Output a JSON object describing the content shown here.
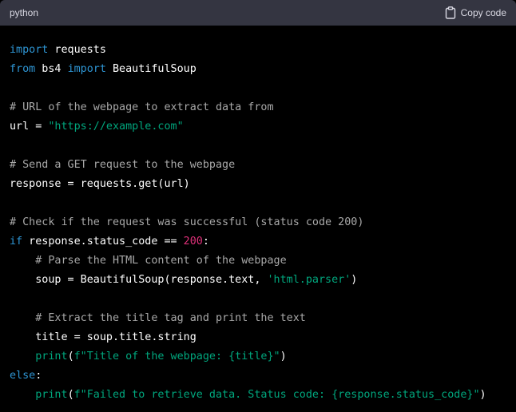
{
  "header": {
    "language": "python",
    "copy_label": "Copy code"
  },
  "colors": {
    "keyword": "#2e95d3",
    "comment": "#a8a8a8",
    "string": "#00a67d",
    "number": "#df3079",
    "plain": "#ffffff",
    "header_bg": "#343541",
    "code_bg": "#000000"
  },
  "icons": {
    "copy": "clipboard-icon"
  },
  "code": {
    "lines": [
      [
        {
          "t": "import",
          "c": "kw"
        },
        {
          "t": " requests",
          "c": "pl"
        }
      ],
      [
        {
          "t": "from",
          "c": "kw"
        },
        {
          "t": " bs4 ",
          "c": "pl"
        },
        {
          "t": "import",
          "c": "kw"
        },
        {
          "t": " BeautifulSoup",
          "c": "pl"
        }
      ],
      [],
      [
        {
          "t": "# URL of the webpage to extract data from",
          "c": "cm"
        }
      ],
      [
        {
          "t": "url = ",
          "c": "pl"
        },
        {
          "t": "\"https://example.com\"",
          "c": "str"
        }
      ],
      [],
      [
        {
          "t": "# Send a GET request to the webpage",
          "c": "cm"
        }
      ],
      [
        {
          "t": "response = requests.get(url)",
          "c": "pl"
        }
      ],
      [],
      [
        {
          "t": "# Check if the request was successful (status code 200)",
          "c": "cm"
        }
      ],
      [
        {
          "t": "if",
          "c": "kw"
        },
        {
          "t": " response.status_code == ",
          "c": "pl"
        },
        {
          "t": "200",
          "c": "num"
        },
        {
          "t": ":",
          "c": "pl"
        }
      ],
      [
        {
          "t": "    ",
          "c": "pl"
        },
        {
          "t": "# Parse the HTML content of the webpage",
          "c": "cm"
        }
      ],
      [
        {
          "t": "    soup = BeautifulSoup(response.text, ",
          "c": "pl"
        },
        {
          "t": "'html.parser'",
          "c": "str"
        },
        {
          "t": ")",
          "c": "pl"
        }
      ],
      [],
      [
        {
          "t": "    ",
          "c": "pl"
        },
        {
          "t": "# Extract the title tag and print the text",
          "c": "cm"
        }
      ],
      [
        {
          "t": "    title = soup.title.string",
          "c": "pl"
        }
      ],
      [
        {
          "t": "    ",
          "c": "pl"
        },
        {
          "t": "print",
          "c": "fn"
        },
        {
          "t": "(",
          "c": "pl"
        },
        {
          "t": "f\"Title of the webpage: {title}\"",
          "c": "str"
        },
        {
          "t": ")",
          "c": "pl"
        }
      ],
      [
        {
          "t": "else",
          "c": "kw"
        },
        {
          "t": ":",
          "c": "pl"
        }
      ],
      [
        {
          "t": "    ",
          "c": "pl"
        },
        {
          "t": "print",
          "c": "fn"
        },
        {
          "t": "(",
          "c": "pl"
        },
        {
          "t": "f\"Failed to retrieve data. Status code: {response.status_code}\"",
          "c": "str"
        },
        {
          "t": ")",
          "c": "pl"
        }
      ]
    ]
  }
}
